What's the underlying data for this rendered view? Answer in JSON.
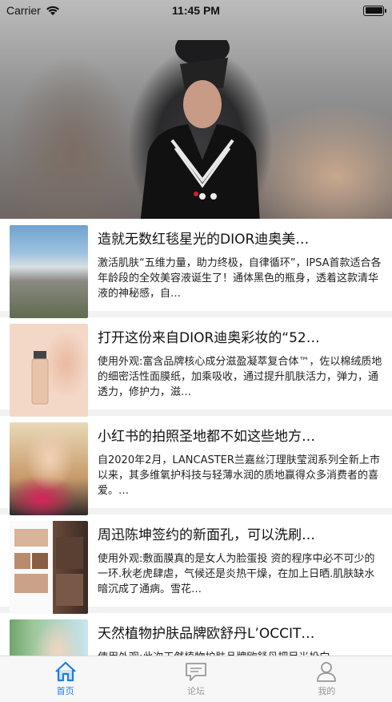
{
  "status_bar": {
    "carrier": "Carrier",
    "time": "11:45 PM"
  },
  "hero": {
    "icon": "runway-photo"
  },
  "feed": {
    "items": [
      {
        "title": "造就无数红毯星光的DIOR迪奥美…",
        "excerpt": "激活肌肤“五维力量，助力终极，自律循环”，IPSA首款适合各年龄段的全效美容液诞生了！通体黑色的瓶身，透着这款清华液的神秘感，自…",
        "thumb_icon": "harbor-photo"
      },
      {
        "title": "打开这份来自DIOR迪奥彩妆的“52…",
        "excerpt": "使用外观:富含品牌核心成分滋盈凝萃复合体™，佐以棉绒质地的细密活性面膜纸，加乘吸收，通过提升肌肤活力，弹力，通透力，修护力，滋…",
        "thumb_icon": "foundation-bottle-photo"
      },
      {
        "title": "小红书的拍照圣地都不如这些地方…",
        "excerpt": "自2020年2月，LANCASTER兰嘉丝汀理肤莹润系列全新上市以来，其多维氧护科技与轻薄水润的质地赢得众多消费者的喜爱。…",
        "thumb_icon": "model-photo"
      },
      {
        "title": "周迅陈坤签约的新面孔，可以洗刷…",
        "excerpt": "使用外观:敷面膜真的是女人为脸蛋投 资的程序中必不可少的一环.秋老虎肆虐，气候还是炎热干燥，在加上日晒.肌肤缺水暗沉成了通病。雪花…",
        "thumb_icon": "collage-photo"
      },
      {
        "title": "天然植物护肤品牌欧舒丹L’OCCIT…",
        "excerpt": "使用外观:此次天然植物护肤品牌欧舒丹把目光投向…",
        "thumb_icon": "portrait-photo"
      }
    ]
  },
  "tabbar": {
    "tabs": [
      {
        "label": "首页",
        "icon": "home-icon",
        "active": true
      },
      {
        "label": "论坛",
        "icon": "chat-bubble-icon",
        "active": false
      },
      {
        "label": "我的",
        "icon": "person-icon",
        "active": false
      }
    ],
    "active_color": "#1a7de8",
    "inactive_color": "#999999"
  }
}
